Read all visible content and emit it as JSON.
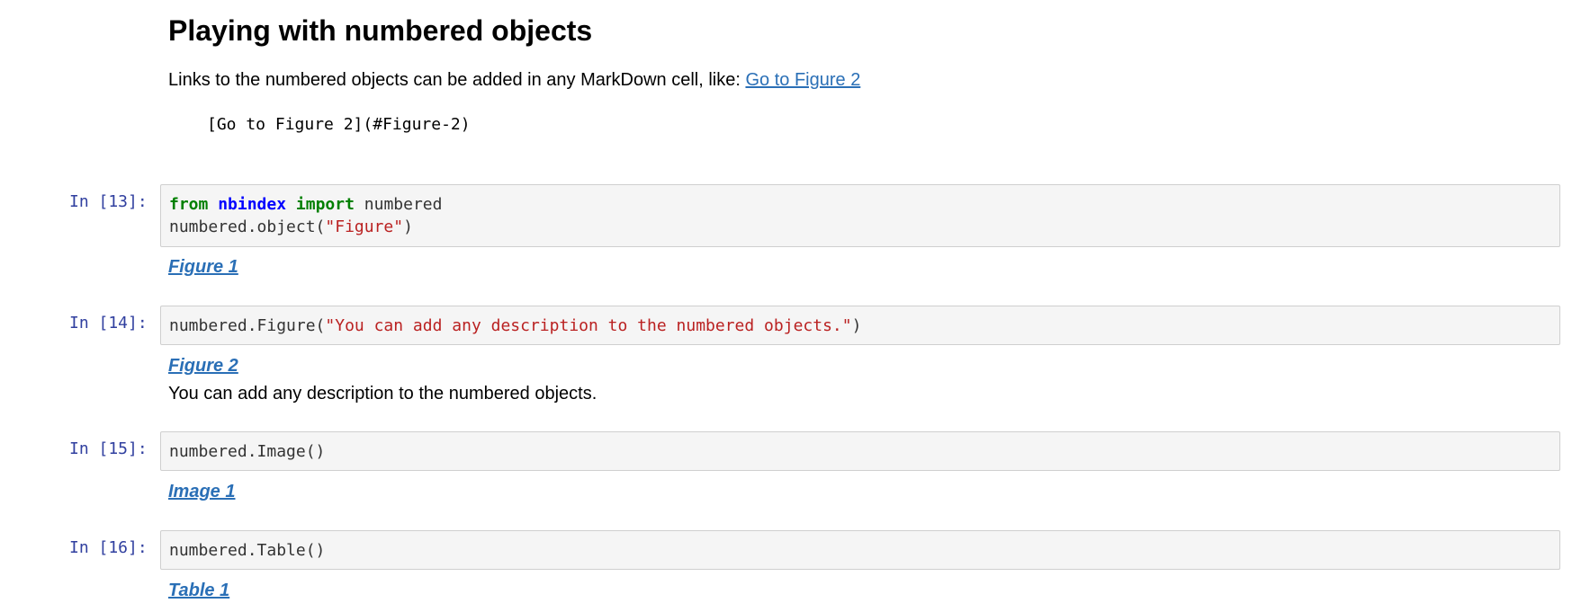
{
  "markdown": {
    "heading": "Playing with numbered objects",
    "paragraph_prefix": "Links to the numbered objects can be added in any MarkDown cell, like: ",
    "link_text": "Go to Figure 2",
    "code_example": "[Go to Figure 2](#Figure-2)"
  },
  "cells": [
    {
      "prompt": "In [13]:",
      "code": {
        "kw_from": "from",
        "module": "nbindex",
        "kw_import": "import",
        "name": " numbered",
        "line2_prefix": "numbered.object(",
        "line2_string": "\"Figure\"",
        "line2_suffix": ")"
      },
      "output_title": "Figure 1"
    },
    {
      "prompt": "In [14]:",
      "code": {
        "prefix": "numbered.Figure(",
        "string": "\"You can add any description to the numbered objects.\"",
        "suffix": ")"
      },
      "output_title": "Figure 2",
      "output_desc": "You can add any description to the numbered objects."
    },
    {
      "prompt": "In [15]:",
      "code": {
        "text": "numbered.Image()"
      },
      "output_title": "Image 1"
    },
    {
      "prompt": "In [16]:",
      "code": {
        "text": "numbered.Table()"
      },
      "output_title": "Table 1"
    }
  ],
  "colors": {
    "prompt": "#303f9f",
    "link": "#2a6fb6",
    "keyword": "#008000",
    "module": "#0000ff",
    "string": "#ba2121",
    "input_bg": "#f5f5f5",
    "input_border": "#cfcfcf"
  }
}
